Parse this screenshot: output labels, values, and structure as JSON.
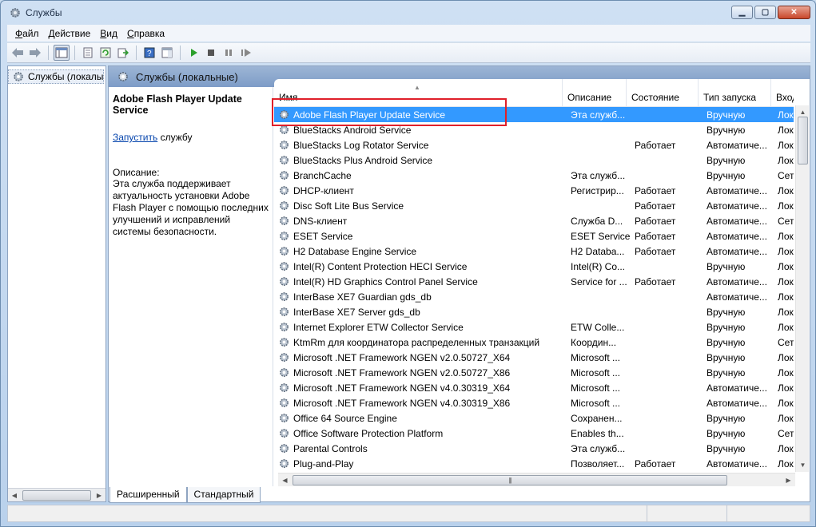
{
  "window": {
    "title": "Службы"
  },
  "menu": [
    {
      "accel": "Ф",
      "rest": "айл"
    },
    {
      "accel": "Д",
      "rest": "ействие"
    },
    {
      "accel": "В",
      "rest": "ид"
    },
    {
      "accel": "С",
      "rest": "правка"
    }
  ],
  "tree": {
    "root_label": "Службы (локалы"
  },
  "main": {
    "header": "Службы (локальные)"
  },
  "details": {
    "title": "Adobe Flash Player Update Service",
    "start_link": "Запустить",
    "start_suffix": " службу",
    "desc_label": "Описание:",
    "desc_text": "Эта служба поддерживает актуальность установки Adobe Flash Player с помощью последних улучшений и исправлений системы безопасности."
  },
  "columns": {
    "name": "Имя",
    "desc": "Описание",
    "state": "Состояние",
    "start": "Тип запуска",
    "login": "Вход"
  },
  "services": [
    {
      "name": "Adobe Flash Player Update Service",
      "desc": "Эта служб...",
      "state": "",
      "start": "Вручную",
      "login": "Лок",
      "selected": true
    },
    {
      "name": "BlueStacks Android Service",
      "desc": "",
      "state": "",
      "start": "Вручную",
      "login": "Лок"
    },
    {
      "name": "BlueStacks Log Rotator Service",
      "desc": "",
      "state": "Работает",
      "start": "Автоматиче...",
      "login": "Лок"
    },
    {
      "name": "BlueStacks Plus Android Service",
      "desc": "",
      "state": "",
      "start": "Вручную",
      "login": "Лок"
    },
    {
      "name": "BranchCache",
      "desc": "Эта служб...",
      "state": "",
      "start": "Вручную",
      "login": "Сет"
    },
    {
      "name": "DHCP-клиент",
      "desc": "Регистрир...",
      "state": "Работает",
      "start": "Автоматиче...",
      "login": "Лок"
    },
    {
      "name": "Disc Soft Lite Bus Service",
      "desc": "",
      "state": "Работает",
      "start": "Автоматиче...",
      "login": "Лок"
    },
    {
      "name": "DNS-клиент",
      "desc": "Служба D...",
      "state": "Работает",
      "start": "Автоматиче...",
      "login": "Сет"
    },
    {
      "name": "ESET Service",
      "desc": "ESET Service",
      "state": "Работает",
      "start": "Автоматиче...",
      "login": "Лок"
    },
    {
      "name": "H2 Database Engine Service",
      "desc": "H2 Databa...",
      "state": "Работает",
      "start": "Автоматиче...",
      "login": "Лок"
    },
    {
      "name": "Intel(R) Content Protection HECI Service",
      "desc": "Intel(R) Co...",
      "state": "",
      "start": "Вручную",
      "login": "Лок"
    },
    {
      "name": "Intel(R) HD Graphics Control Panel Service",
      "desc": "Service for ...",
      "state": "Работает",
      "start": "Автоматиче...",
      "login": "Лок"
    },
    {
      "name": "InterBase XE7 Guardian gds_db",
      "desc": "",
      "state": "",
      "start": "Автоматиче...",
      "login": "Лок"
    },
    {
      "name": "InterBase XE7 Server gds_db",
      "desc": "",
      "state": "",
      "start": "Вручную",
      "login": "Лок"
    },
    {
      "name": "Internet Explorer ETW Collector Service",
      "desc": "ETW Colle...",
      "state": "",
      "start": "Вручную",
      "login": "Лок"
    },
    {
      "name": "KtmRm для координатора распределенных транзакций",
      "desc": "Координ...",
      "state": "",
      "start": "Вручную",
      "login": "Сет"
    },
    {
      "name": "Microsoft .NET Framework NGEN v2.0.50727_X64",
      "desc": "Microsoft ...",
      "state": "",
      "start": "Вручную",
      "login": "Лок"
    },
    {
      "name": "Microsoft .NET Framework NGEN v2.0.50727_X86",
      "desc": "Microsoft ...",
      "state": "",
      "start": "Вручную",
      "login": "Лок"
    },
    {
      "name": "Microsoft .NET Framework NGEN v4.0.30319_X64",
      "desc": "Microsoft ...",
      "state": "",
      "start": "Автоматиче...",
      "login": "Лок"
    },
    {
      "name": "Microsoft .NET Framework NGEN v4.0.30319_X86",
      "desc": "Microsoft ...",
      "state": "",
      "start": "Автоматиче...",
      "login": "Лок"
    },
    {
      "name": "Office 64 Source Engine",
      "desc": "Сохранен...",
      "state": "",
      "start": "Вручную",
      "login": "Лок"
    },
    {
      "name": "Office Software Protection Platform",
      "desc": "Enables th...",
      "state": "",
      "start": "Вручную",
      "login": "Сет"
    },
    {
      "name": "Parental Controls",
      "desc": "Эта служб...",
      "state": "",
      "start": "Вручную",
      "login": "Лок"
    },
    {
      "name": "Plug-and-Play",
      "desc": "Позволяет...",
      "state": "Работает",
      "start": "Автоматиче...",
      "login": "Лок"
    }
  ],
  "tabs": [
    "Расширенный",
    "Стандартный"
  ],
  "icons": {
    "app": "services-gear-icon",
    "back": "back-arrow-icon",
    "forward": "forward-arrow-icon",
    "play": "play-icon",
    "stop": "stop-icon",
    "pause": "pause-icon",
    "restart": "restart-icon"
  },
  "colors": {
    "selection": "#3399ff",
    "highlight_box": "#e0202a",
    "link": "#0645ad"
  }
}
